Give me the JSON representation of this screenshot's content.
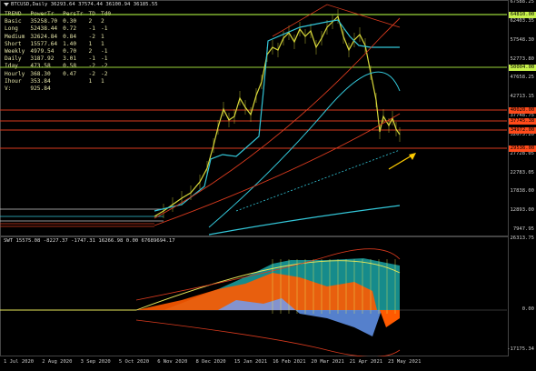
{
  "window": {
    "header": "BTCUSD,Daily  36293.64 37574.44 36100.94 36185.55",
    "sub_header": "SWT 15575.08 -8227.37 -1747.31 16266.98 0.00 67689694.17"
  },
  "trend_table": {
    "headers": [
      "TREND",
      "PowerTr",
      "PersTr",
      "TD",
      "Td0"
    ],
    "rows": [
      [
        "Basic",
        "35258.70",
        "0.30",
        "2",
        "2"
      ],
      [
        "Long",
        "52438.44",
        "0.72",
        "-1",
        "-1"
      ],
      [
        "Medium",
        "32624.84",
        "0.84",
        "-2",
        "1"
      ],
      [
        "Short",
        "15577.64",
        "1.40",
        "1",
        "1"
      ],
      [
        "Weekly",
        "4979.54",
        "0.70",
        "2",
        "-1"
      ],
      [
        "Daily",
        "3187.92",
        "3.01",
        "-1",
        "-1"
      ],
      [
        "Iday",
        "473.58",
        "0.58",
        "-2",
        "-2"
      ],
      [
        "Hourly",
        "368.30",
        "0.47",
        "-2",
        "-2"
      ],
      [
        "Ihour",
        "353.84",
        "",
        "1",
        "1"
      ],
      [
        "V:",
        "925.84",
        "",
        "",
        ""
      ]
    ]
  },
  "price_axis": [
    "67588.25",
    "62403.35",
    "57548.30",
    "52773.80",
    "47658.25",
    "42713.15",
    "37748.75",
    "32673.20",
    "27728.05",
    "22783.05",
    "17838.00",
    "12893.00",
    "7947.95"
  ],
  "price_tags": {
    "green1": "64810.00",
    "green2": "50004.00",
    "red1": "40020.00",
    "red2": "37745.38",
    "red3": "34972.00",
    "red4": "29536.00"
  },
  "sub_axis": [
    "26313.75",
    "0.00",
    "-17175.34"
  ],
  "date_axis": [
    "1 Jul 2020",
    "2 Aug 2020",
    "3 Sep 2020",
    "5 Oct 2020",
    "6 Nov 2020",
    "8 Dec 2020",
    "15 Jan 2021",
    "16 Feb 2021",
    "20 Mar 2021",
    "21 Apr 2021",
    "23 May 2021"
  ],
  "colors": {
    "price_line": "#d8d83a",
    "cyan": "#33c6d8",
    "red": "#d83a1e",
    "green_line": "#9ad53a",
    "orange_fill": "#ff5a00",
    "teal_fill": "#1aa3a3",
    "blue_fill": "#6aa0ff",
    "arrow": "#ffcc00"
  }
}
